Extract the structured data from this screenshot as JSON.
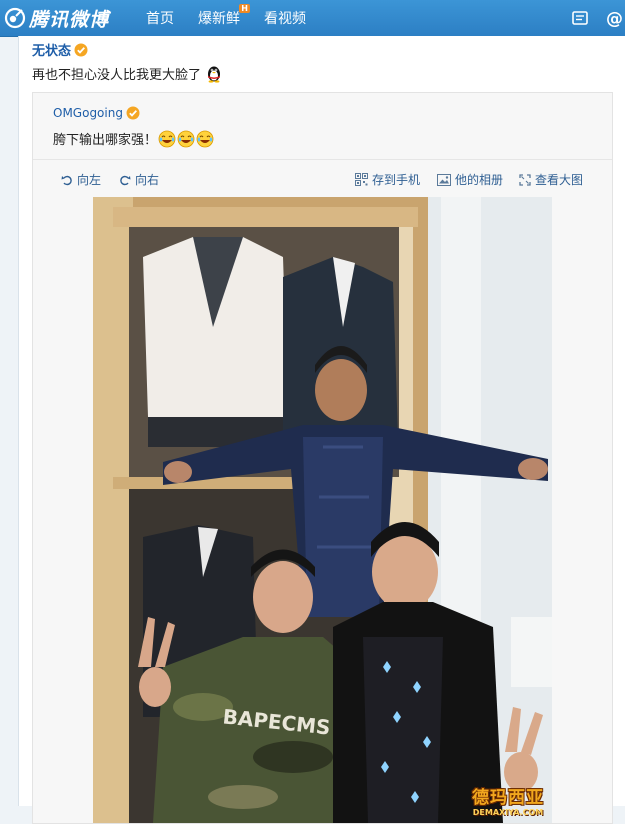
{
  "app": {
    "logo_text": "腾讯微博"
  },
  "nav": {
    "items": [
      "首页",
      "爆新鲜",
      "看视频"
    ],
    "hot_badge": "H"
  },
  "header_icons": [
    "message-icon",
    "at-icon"
  ],
  "post": {
    "author": "无状态",
    "text": "再也不担心没人比我更大脸了",
    "emoji": "qq-penguin-emoji"
  },
  "repost": {
    "author": "OMGogoing",
    "text": "胯下输出哪家强！",
    "emoji": [
      "laugh-emoji",
      "laugh-emoji",
      "laugh-emoji"
    ]
  },
  "toolbar": {
    "rotate_left": "向左",
    "rotate_right": "向右",
    "save_to_phone": "存到手机",
    "his_album": "他的相册",
    "view_large": "查看大图"
  },
  "watermark": {
    "main": "德玛西亚",
    "sub": "DEMAXIYA.COM"
  },
  "colors": {
    "topbar": "#2c7fc4",
    "link": "#1f5ea8",
    "verified": "#f5a623"
  }
}
